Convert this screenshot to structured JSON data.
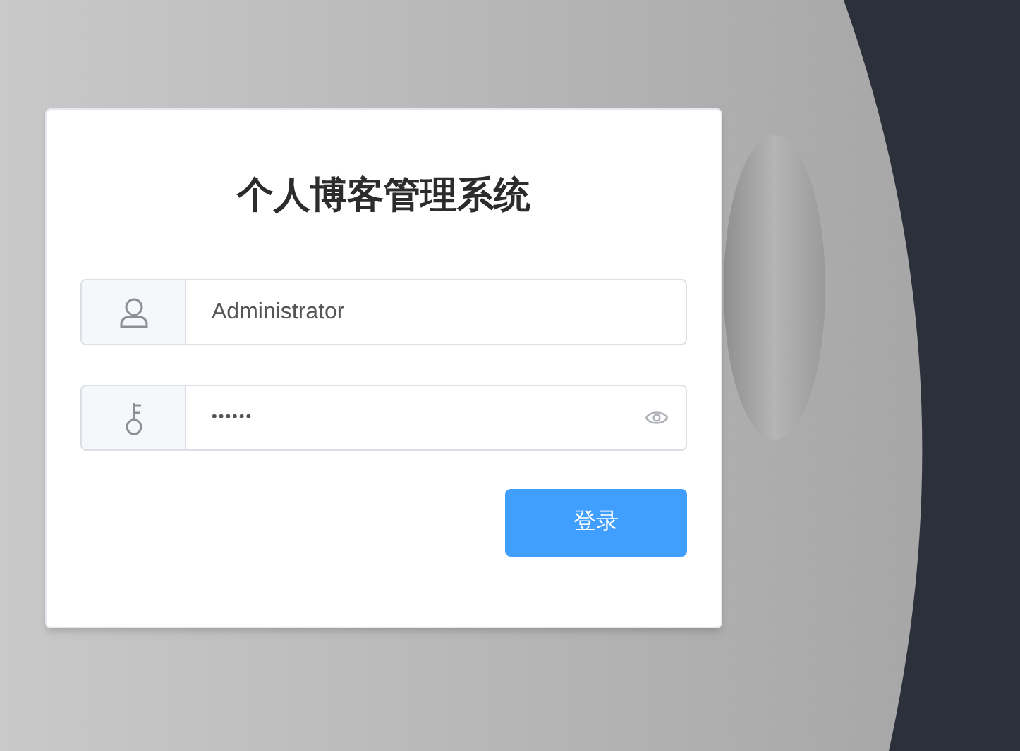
{
  "title": "个人博客管理系统",
  "fields": [
    {
      "kind": "user",
      "value": "Administrator"
    },
    {
      "kind": "password",
      "value": "••••••"
    }
  ],
  "login_button": "登录"
}
